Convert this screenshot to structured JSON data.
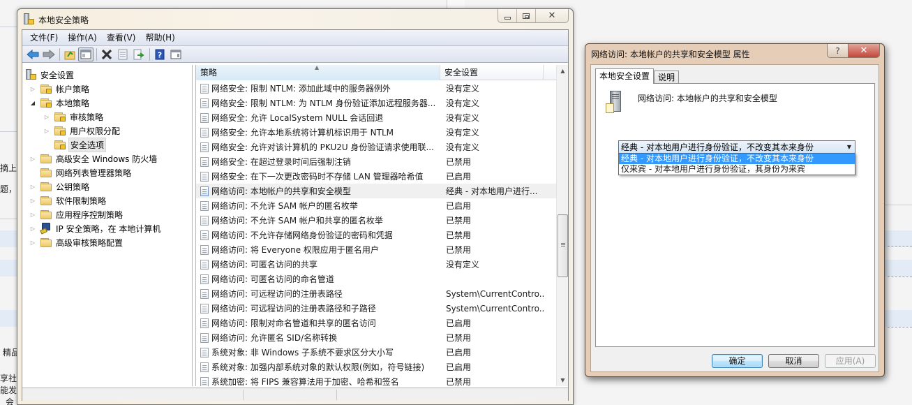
{
  "background": {
    "fragments": [
      "摘上",
      "题，",
      "精品",
      "享社",
      "能发",
      "会"
    ]
  },
  "main_window": {
    "title": "本地安全策略",
    "menu": [
      "文件(F)",
      "操作(A)",
      "查看(V)",
      "帮助(H)"
    ],
    "toolbar": {
      "back": "back-arrow-icon",
      "forward": "forward-arrow-icon",
      "up": "up-folder-icon",
      "show_hide_tree": "show-hide-tree-icon",
      "delete": "delete-icon",
      "properties": "properties-icon",
      "export": "export-list-icon",
      "help": "help-icon",
      "show_hide_action": "show-hide-action-pane-icon"
    },
    "tree": {
      "root": "安全设置",
      "items": [
        {
          "label": "帐户策略",
          "level": 1,
          "expander": "collapsed",
          "icon": "locked-folder"
        },
        {
          "label": "本地策略",
          "level": 1,
          "expander": "expanded",
          "icon": "locked-folder"
        },
        {
          "label": "审核策略",
          "level": 2,
          "expander": "collapsed",
          "icon": "locked-folder"
        },
        {
          "label": "用户权限分配",
          "level": 2,
          "expander": "collapsed",
          "icon": "locked-folder"
        },
        {
          "label": "安全选项",
          "level": 2,
          "expander": "none",
          "icon": "locked-folder",
          "selected": true
        },
        {
          "label": "高级安全 Windows 防火墙",
          "level": 1,
          "expander": "collapsed",
          "icon": "folder"
        },
        {
          "label": "网络列表管理器策略",
          "level": 1,
          "expander": "none",
          "icon": "folder"
        },
        {
          "label": "公钥策略",
          "level": 1,
          "expander": "collapsed",
          "icon": "folder"
        },
        {
          "label": "软件限制策略",
          "level": 1,
          "expander": "collapsed",
          "icon": "folder"
        },
        {
          "label": "应用程序控制策略",
          "level": 1,
          "expander": "collapsed",
          "icon": "folder"
        },
        {
          "label": "IP 安全策略，在 本地计算机",
          "level": 1,
          "expander": "collapsed",
          "icon": "ipsec"
        },
        {
          "label": "高级审核策略配置",
          "level": 1,
          "expander": "collapsed",
          "icon": "folder"
        }
      ]
    },
    "list": {
      "columns": [
        "策略",
        "安全设置"
      ],
      "rows": [
        {
          "policy": "网络安全: 限制 NTLM: 添加此域中的服务器例外",
          "setting": "没有定义"
        },
        {
          "policy": "网络安全: 限制 NTLM: 为 NTLM 身份验证添加远程服务器...",
          "setting": "没有定义"
        },
        {
          "policy": "网络安全: 允许 LocalSystem NULL 会话回退",
          "setting": "没有定义"
        },
        {
          "policy": "网络安全: 允许本地系统将计算机标识用于 NTLM",
          "setting": "没有定义"
        },
        {
          "policy": "网络安全: 允许对该计算机的 PKU2U 身份验证请求使用联...",
          "setting": "没有定义"
        },
        {
          "policy": "网络安全: 在超过登录时间后强制注销",
          "setting": "已禁用"
        },
        {
          "policy": "网络安全: 在下一次更改密码时不存储 LAN 管理器哈希值",
          "setting": "已启用"
        },
        {
          "policy": "网络访问: 本地帐户的共享和安全模型",
          "setting": "经典 - 对本地用户进行...",
          "highlighted": true
        },
        {
          "policy": "网络访问: 不允许 SAM 帐户的匿名枚举",
          "setting": "已启用"
        },
        {
          "policy": "网络访问: 不允许 SAM 帐户和共享的匿名枚举",
          "setting": "已禁用"
        },
        {
          "policy": "网络访问: 不允许存储网络身份验证的密码和凭据",
          "setting": "已禁用"
        },
        {
          "policy": "网络访问: 将 Everyone 权限应用于匿名用户",
          "setting": "已禁用"
        },
        {
          "policy": "网络访问: 可匿名访问的共享",
          "setting": "没有定义"
        },
        {
          "policy": "网络访问: 可匿名访问的命名管道",
          "setting": ""
        },
        {
          "policy": "网络访问: 可远程访问的注册表路径",
          "setting": "System\\CurrentContro..."
        },
        {
          "policy": "网络访问: 可远程访问的注册表路径和子路径",
          "setting": "System\\CurrentContro..."
        },
        {
          "policy": "网络访问: 限制对命名管道和共享的匿名访问",
          "setting": "已启用"
        },
        {
          "policy": "网络访问: 允许匿名 SID/名称转换",
          "setting": "已禁用"
        },
        {
          "policy": "系统对象: 非 Windows 子系统不要求区分大小写",
          "setting": "已启用"
        },
        {
          "policy": "系统对象: 加强内部系统对象的默认权限(例如，符号链接)",
          "setting": "已启用"
        },
        {
          "policy": "系统加密: 将 FIPS 兼容算法用于加密、哈希和签名",
          "setting": "已禁用"
        }
      ]
    }
  },
  "dialog": {
    "title": "网络访问: 本地帐户的共享和安全模型 属性",
    "help_button": "?",
    "close_button": "x",
    "tabs": [
      {
        "label": "本地安全设置",
        "active": true
      },
      {
        "label": "说明",
        "active": false
      }
    ],
    "policy_name": "网络访问: 本地帐户的共享和安全模型",
    "combo": {
      "value": "经典 - 对本地用户进行身份验证，不改变其本来身份",
      "options": [
        {
          "label": "经典 - 对本地用户进行身份验证，不改变其本来身份",
          "selected": true
        },
        {
          "label": "仅来宾 - 对本地用户进行身份验证，其身份为来宾",
          "selected": false
        }
      ]
    },
    "buttons": {
      "ok": "确定",
      "cancel": "取消",
      "apply": "应用(A)"
    }
  }
}
